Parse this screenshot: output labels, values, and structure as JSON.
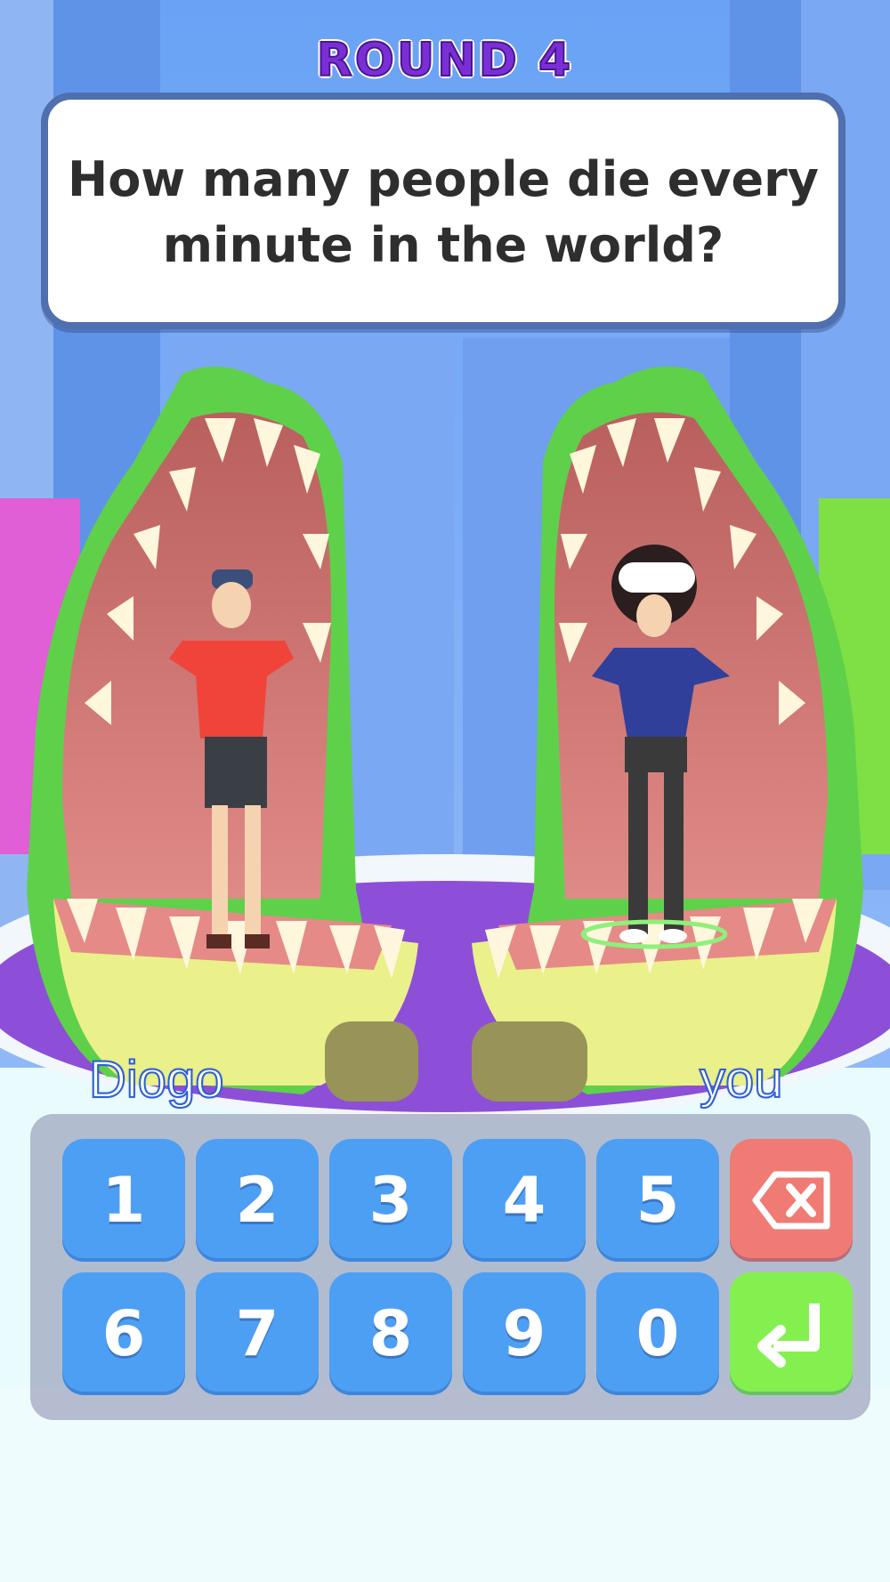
{
  "game": {
    "round_label": "ROUND 4",
    "question": "How many people die every minute in the world?",
    "players": {
      "opponent_name": "Diogo",
      "player_name": "you"
    }
  },
  "keypad": {
    "digits": [
      "1",
      "2",
      "3",
      "4",
      "5",
      "6",
      "7",
      "8",
      "9",
      "0"
    ],
    "delete_icon": "backspace-icon",
    "enter_icon": "enter-icon"
  },
  "colors": {
    "accent_purple": "#7a2fd6",
    "key_blue": "#4d9ff4",
    "delete_red": "#ef7b74",
    "enter_green": "#83f04f"
  }
}
